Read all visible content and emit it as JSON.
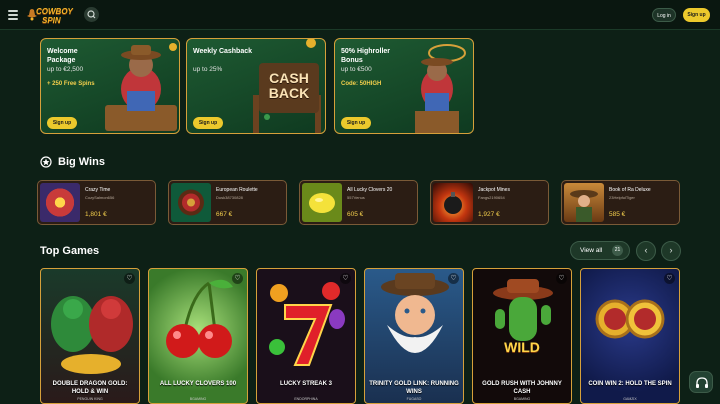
{
  "header": {
    "logo_line1": "COWBOY",
    "logo_line2": "SPIN",
    "login_label": "Log in",
    "signup_label": "Sign up"
  },
  "promos": [
    {
      "title": "Welcome Package",
      "subtitle": "up to €2,500",
      "extra": "+ 250 Free Spins",
      "button": "Sign up"
    },
    {
      "title": "Weekly Cashback",
      "subtitle": "up to 25%",
      "extra": "",
      "sign": "CASH BACK",
      "button": "Sign up"
    },
    {
      "title": "50% Highroller Bonus",
      "subtitle": "up to €500",
      "extra": "Code: 50HIGH",
      "button": "Sign up"
    }
  ],
  "big_wins": {
    "title": "Big Wins",
    "items": [
      {
        "game": "Crazy Time",
        "user": "CozySalmon656",
        "amount": "1,801 €"
      },
      {
        "game": "European Roulette",
        "user": "Dusk38730828",
        "amount": "667 €"
      },
      {
        "game": "All Lucky Clovers 20",
        "user": "557Venus",
        "amount": "605 €"
      },
      {
        "game": "Jackpot Mines",
        "user": "Fangs2190654",
        "amount": "1,927 €"
      },
      {
        "game": "Book of Ra Deluxe",
        "user": "23HelpfulTiger",
        "amount": "585 €"
      }
    ]
  },
  "top_games": {
    "title": "Top Games",
    "view_all_label": "View all",
    "view_all_count": "21",
    "games": [
      {
        "title": "DOUBLE DRAGON GOLD: HOLD & WIN",
        "provider": "PENGUIN KING"
      },
      {
        "title": "ALL LUCKY CLOVERS 100",
        "provider": "BGAMING"
      },
      {
        "title": "LUCKY STREAK 3",
        "provider": "ENDORPHINA"
      },
      {
        "title": "TRINITY GOLD LINK: RUNNING WINS",
        "provider": "FUGASO"
      },
      {
        "title": "GOLD RUSH WITH JOHNNY CASH",
        "provider": "BGAMING"
      },
      {
        "title": "COIN WIN 2: HOLD THE SPIN",
        "provider": "GAMZIX"
      }
    ],
    "wild_text": "WILD"
  },
  "colors": {
    "bg": "#0d2016",
    "accent": "#ecc92c",
    "gold_border": "#d6a03a",
    "amount": "#f3cf4c"
  }
}
